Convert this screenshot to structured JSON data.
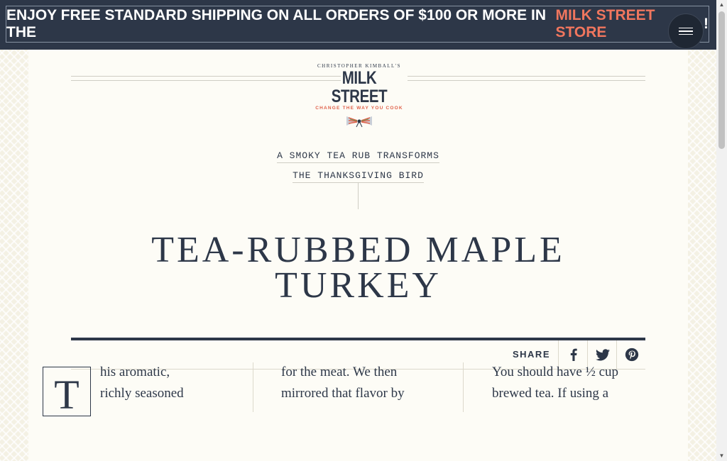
{
  "banner": {
    "text_prefix": "ENJOY FREE STANDARD SHIPPING ON ALL ORDERS OF $100 OR MORE IN THE ",
    "store_link": "MILK STREET STORE",
    "text_suffix": "!",
    "accent_color": "#f0765e",
    "background_color": "#2d3748"
  },
  "menu": {
    "icon": "hamburger-icon"
  },
  "logo": {
    "top_line": "CHRISTOPHER KIMBALL'S",
    "brand": "MILK STREET",
    "tagline": "CHANGE THE WAY YOU COOK"
  },
  "article": {
    "dek_line1": "A SMOKY TEA RUB TRANSFORMS",
    "dek_line2": "THE THANKSGIVING BIRD",
    "title_line1": "TEA-RUBBED MAPLE",
    "title_line2": "TURKEY",
    "share_label": "SHARE",
    "share_icons": [
      "facebook-icon",
      "twitter-icon",
      "pinterest-icon"
    ],
    "drop_cap": "T",
    "col1_lines": [
      "his aromatic,",
      "richly seasoned"
    ],
    "col2_lines": [
      "for the meat. We then",
      "mirrored that flavor by"
    ],
    "col3_lines": [
      "You should have ½ cup",
      "brewed tea. If using a"
    ]
  }
}
